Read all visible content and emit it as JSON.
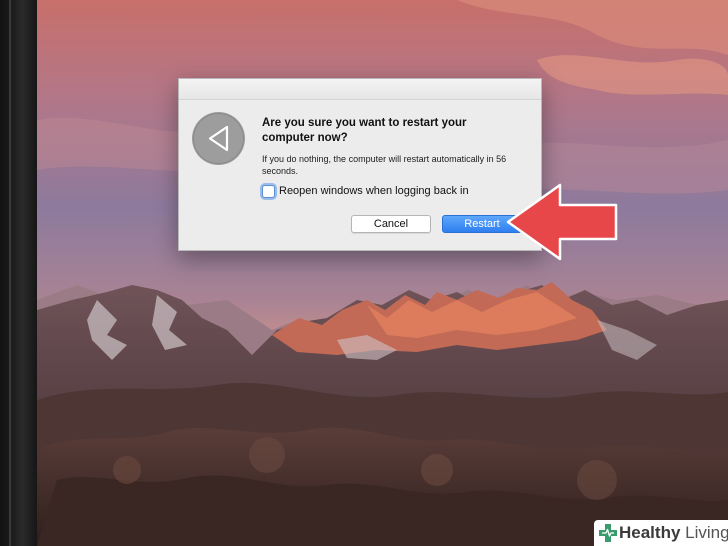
{
  "dialog": {
    "title": "Are you sure you want to restart your computer now?",
    "message": "If you do nothing, the computer will restart automatically in 56 seconds.",
    "checkbox_label": "Reopen windows when logging back in",
    "checkbox_checked": false,
    "cancel_label": "Cancel",
    "restart_label": "Restart",
    "icon": "restart-triangle-icon"
  },
  "annotation": {
    "arrow_color": "#e8474a",
    "points_to": "restart-button"
  },
  "watermark": {
    "brand_bold": "Healthy",
    "brand_light": "Living",
    "icon": "medical-cross-icon",
    "color": "#3a9b6f"
  },
  "colors": {
    "accent": "#3a86f2",
    "dialog_background": "#ececec"
  }
}
